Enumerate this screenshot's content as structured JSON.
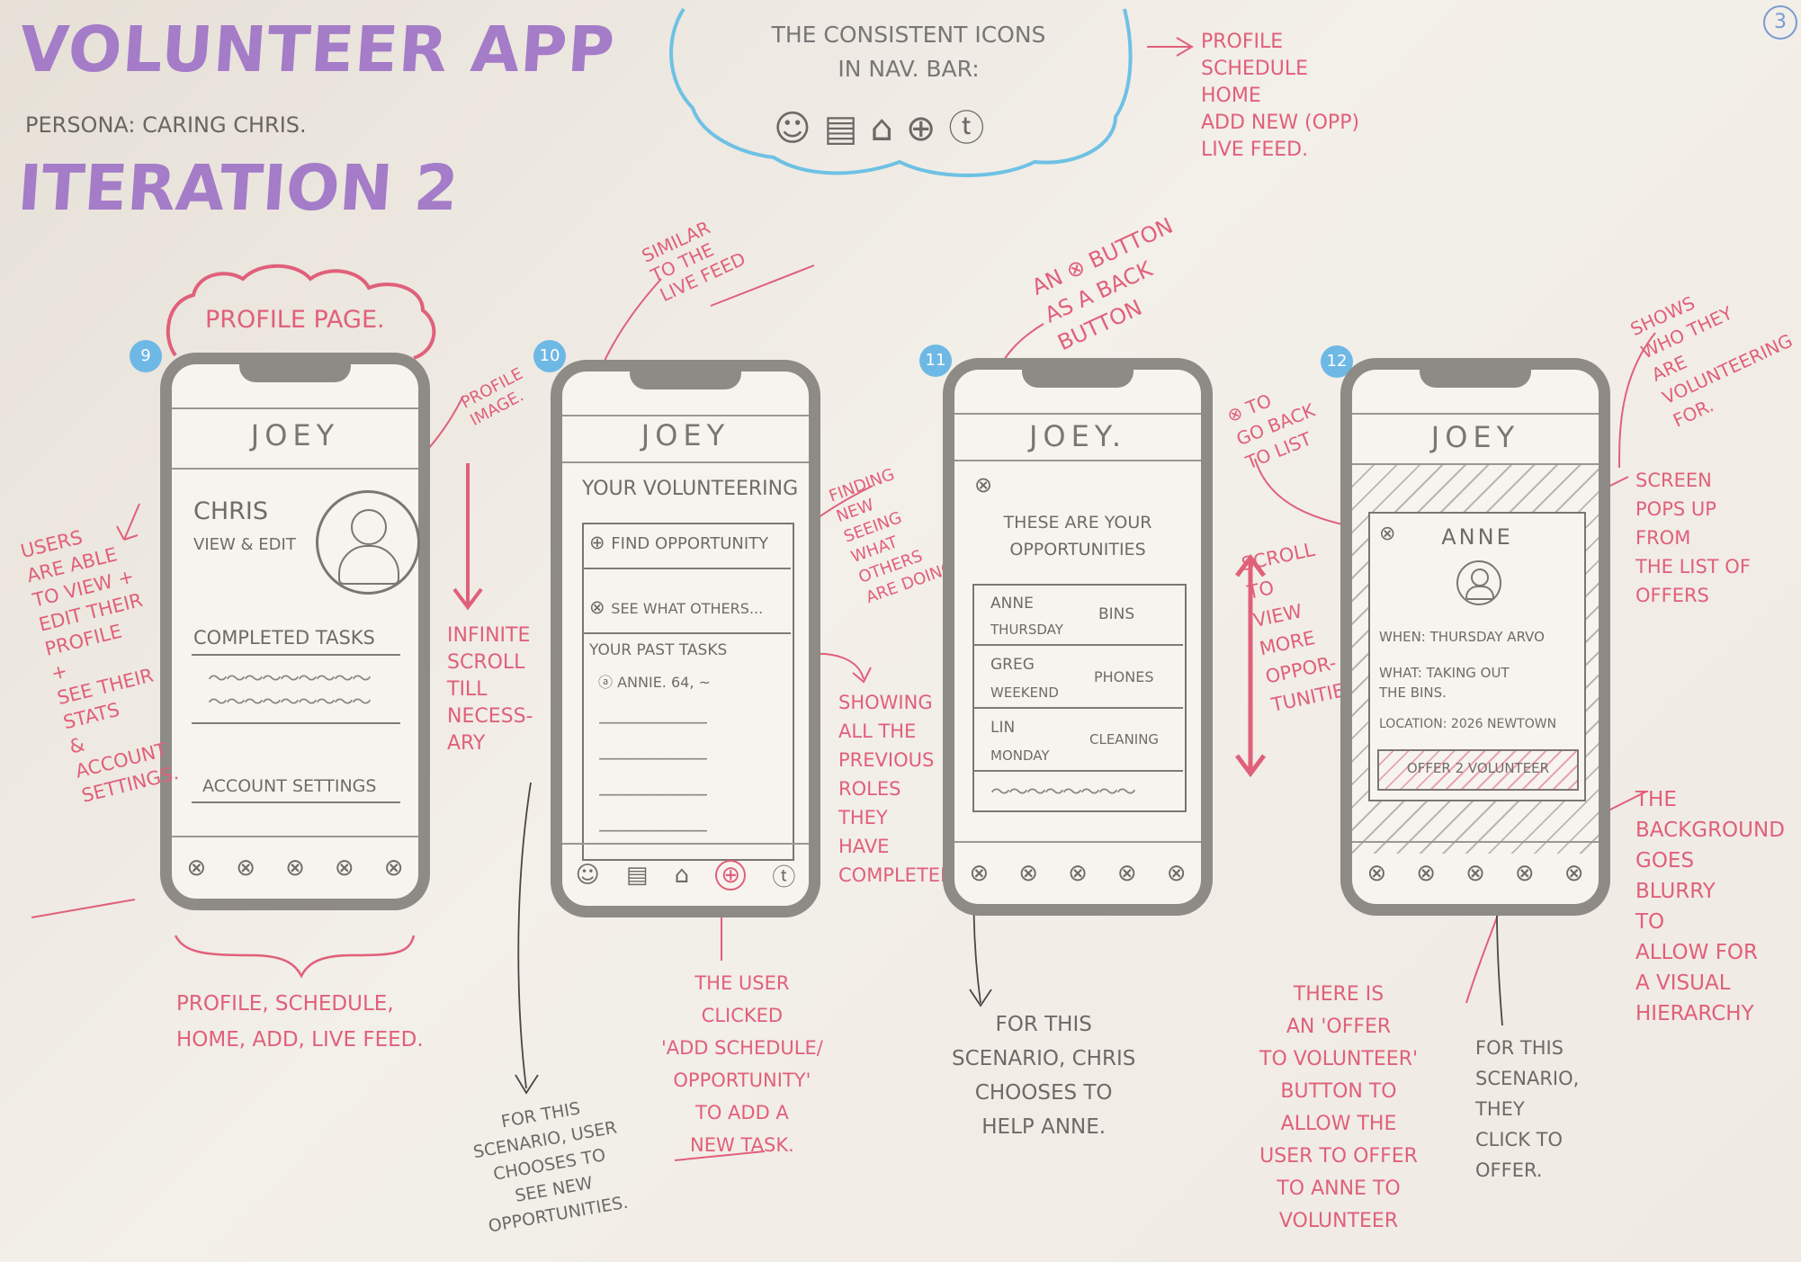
{
  "header": {
    "title": "VOLUNTEER APP",
    "persona": "PERSONA: CARING CHRIS.",
    "iteration": "ITERATION 2",
    "page_number": "3"
  },
  "nav_cloud": {
    "title": "THE CONSISTENT ICONS\nIN NAV. BAR:",
    "icons": [
      "person-icon",
      "schedule-icon",
      "home-icon",
      "add-icon",
      "live-feed-icon"
    ],
    "legend": "PROFILE\nSCHEDULE\nHOME\nADD NEW (OPP)\nLIVE FEED."
  },
  "colors": {
    "purple": "#a47cc8",
    "pink": "#e0607a",
    "blue": "#6eb8e6",
    "pencil": "#8e8a86"
  },
  "screens": [
    {
      "number": "9",
      "cloud_label": "PROFILE PAGE.",
      "title": "JOEY",
      "name": "CHRIS",
      "view_edit": "VIEW & EDIT",
      "completed": "COMPLETED TASKS",
      "settings": "ACCOUNT SETTINGS",
      "left_note": "USERS\nARE ABLE\nTO VIEW +\nEDIT THEIR\nPROFILE\n+\nSEE THEIR\nSTATS\n&\nACCOUNT\nSETTINGS.",
      "profile_image_note": "PROFILE\nIMAGE.",
      "scroll_note": "INFINITE\nSCROLL\nTILL\nNECESS-\nARY",
      "bottom_note": "PROFILE, SCHEDULE,\nHOME, ADD, LIVE FEED."
    },
    {
      "number": "10",
      "title": "JOEY",
      "heading": "YOUR VOLUNTEERING",
      "find": "FIND OPPORTUNITY",
      "see_others": "SEE WHAT OTHERS...",
      "past": "YOUR PAST TASKS",
      "past_item": "ANNIE. 64, ~",
      "top_note": "SIMILAR\nTO THE\nLIVE FEED",
      "finding_note": "FINDING\nNEW\nSEEING\nWHAT\nOTHERS\nARE DOING",
      "showing_note": "SHOWING\nALL THE\nPREVIOUS\nROLES\nTHEY\nHAVE\nCOMPLETED",
      "clicked_note": "THE USER\nCLICKED\n'ADD SCHEDULE/\nOPPORTUNITY'\nTO ADD A\nNEW TASK.",
      "scenario_note": "FOR THIS\nSCENARIO, USER\nCHOOSES TO\nSEE NEW\nOPPORTUNITIES."
    },
    {
      "number": "11",
      "title": "JOEY.",
      "heading": "THESE ARE YOUR\nOPPORTUNITIES",
      "items": [
        {
          "name": "ANNE",
          "day": "THURSDAY",
          "task": "BINS"
        },
        {
          "name": "GREG",
          "day": "WEEKEND",
          "task": "PHONES"
        },
        {
          "name": "LIN",
          "day": "MONDAY",
          "task": "CLEANING"
        }
      ],
      "top_note": "AN ⊗ BUTTON\nAS A BACK\nBUTTON",
      "side_note": "⊗ TO\nGO BACK\nTO LIST",
      "scroll_note": "SCROLL\nTO\nVIEW\nMORE\nOPPOR-\nTUNITIES",
      "bottom_note": "FOR THIS\nSCENARIO, CHRIS\nCHOOSES TO\nHELP ANNE."
    },
    {
      "number": "12",
      "title": "JOEY",
      "popup_name": "ANNE",
      "when": "WHEN: THURSDAY ARVO",
      "what": "WHAT: TAKING OUT\nTHE BINS.",
      "location": "LOCATION: 2026 NEWTOWN",
      "offer": "OFFER 2 VOLUNTEER",
      "shows_note": "SHOWS\nWHO THEY\nARE\nVOLUNTEERING\nFOR.",
      "popup_note": "SCREEN\nPOPS UP\nFROM\nTHE LIST OF\nOFFERS",
      "blur_note": "THE\nBACKGROUND\nGOES\nBLURRY\nTO\nALLOW FOR\nA VISUAL\nHIERARCHY",
      "offer_note": "THERE IS\nAN 'OFFER\nTO VOLUNTEER'\nBUTTON TO\nALLOW THE\nUSER TO OFFER\nTO ANNE TO\nVOLUNTEER",
      "click_note": "FOR THIS\nSCENARIO,\nTHEY\nCLICK TO\nOFFER."
    }
  ]
}
